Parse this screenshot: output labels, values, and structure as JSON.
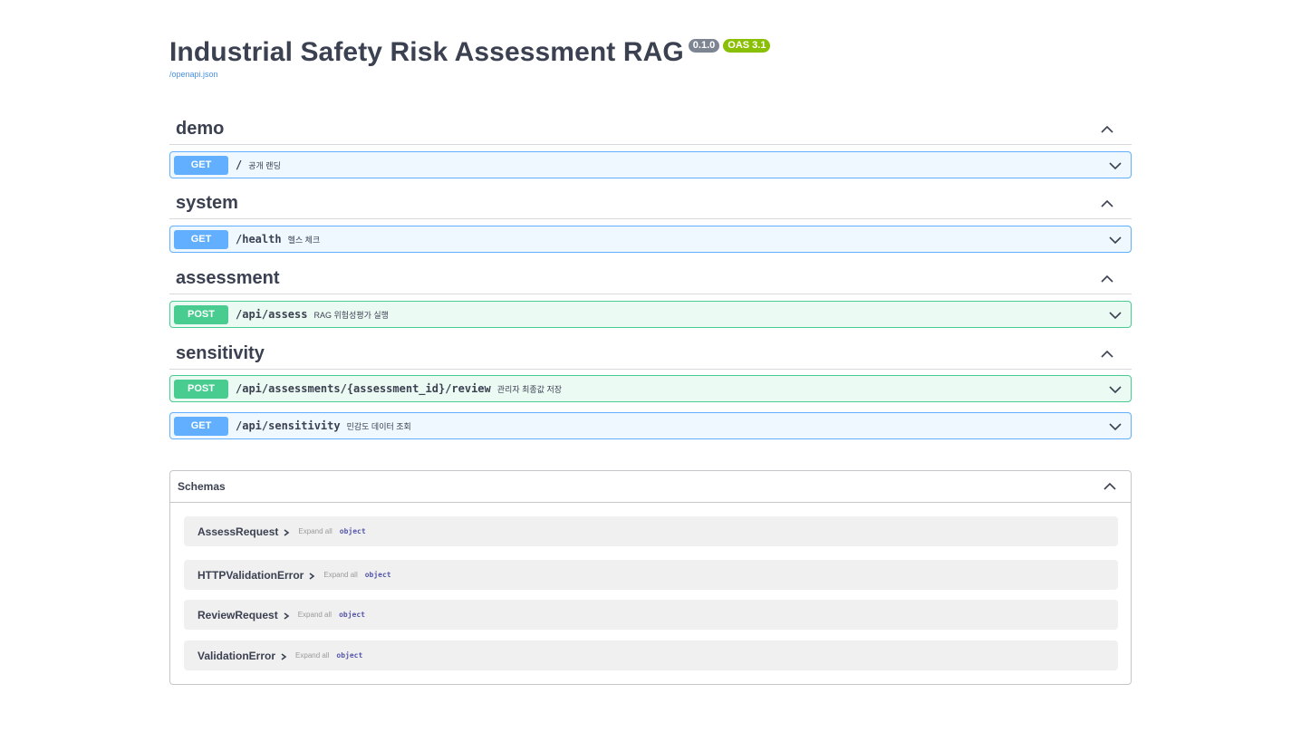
{
  "info": {
    "title": "Industrial Safety Risk Assessment RAG",
    "version": "0.1.0",
    "oas": "OAS 3.1",
    "spec_link": "/openapi.json"
  },
  "tags": [
    {
      "name": "demo",
      "operations": [
        {
          "method": "GET",
          "path": "/",
          "summary": "공개 랜딩"
        }
      ]
    },
    {
      "name": "system",
      "operations": [
        {
          "method": "GET",
          "path": "/health",
          "summary": "헬스 체크"
        }
      ]
    },
    {
      "name": "assessment",
      "operations": [
        {
          "method": "POST",
          "path": "/api/assess",
          "summary": "RAG 위험성평가 실행"
        }
      ]
    },
    {
      "name": "sensitivity",
      "operations": [
        {
          "method": "POST",
          "path": "/api/assessments/{assessment_id}/review",
          "summary": "관리자 최종값 저장"
        },
        {
          "method": "GET",
          "path": "/api/sensitivity",
          "summary": "민감도 데이터 조회"
        }
      ]
    }
  ],
  "schemas": {
    "title": "Schemas",
    "models": [
      {
        "name": "AssessRequest",
        "expand": "Expand all",
        "type": "object"
      },
      {
        "name": "HTTPValidationError",
        "expand": "Expand all",
        "type": "object"
      },
      {
        "name": "ReviewRequest",
        "expand": "Expand all",
        "type": "object"
      },
      {
        "name": "ValidationError",
        "expand": "Expand all",
        "type": "object"
      }
    ]
  },
  "colors": {
    "get": "#61affe",
    "post": "#49cc90",
    "version_badge": "#7d8492",
    "oas_badge": "#89bf04",
    "link": "#4990e2"
  },
  "icons": {
    "collapse": "chevron-up-icon",
    "expand": "chevron-down-icon",
    "model_toggle": "chevron-right-icon"
  }
}
